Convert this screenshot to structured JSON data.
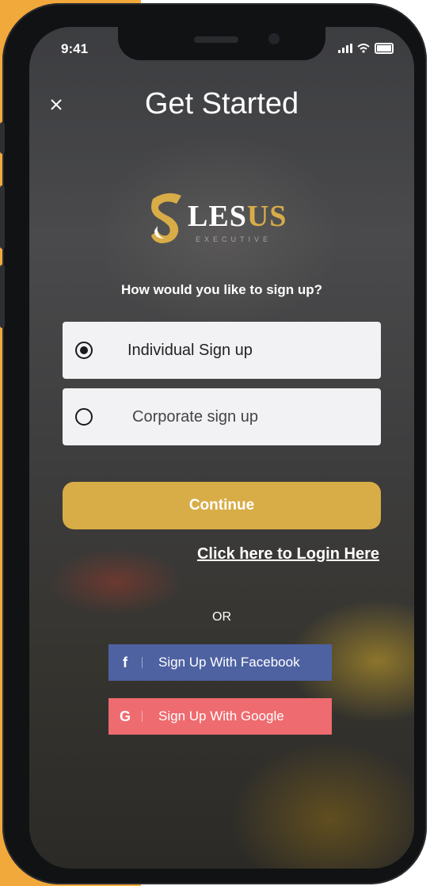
{
  "status_bar": {
    "time": "9:41"
  },
  "header": {
    "title": "Get Started"
  },
  "logo": {
    "brand_main": "LES",
    "brand_accent": "US",
    "brand_sub": "EXECUTIVE"
  },
  "signup": {
    "question": "How would you like to sign up?",
    "options": [
      {
        "label": "Individual Sign up",
        "selected": true
      },
      {
        "label": "Corporate sign up",
        "selected": false
      }
    ],
    "continue_label": "Continue",
    "login_link": "Click here to Login Here",
    "or_label": "OR"
  },
  "social": {
    "facebook": {
      "icon_letter": "f",
      "label": "Sign Up With Facebook"
    },
    "google": {
      "icon_letter": "G",
      "label": "Sign Up With Google"
    }
  },
  "colors": {
    "accent": "#d8ac47",
    "background_accent": "#f2a93b",
    "facebook": "#4e62a2",
    "google": "#ee6b6f"
  }
}
